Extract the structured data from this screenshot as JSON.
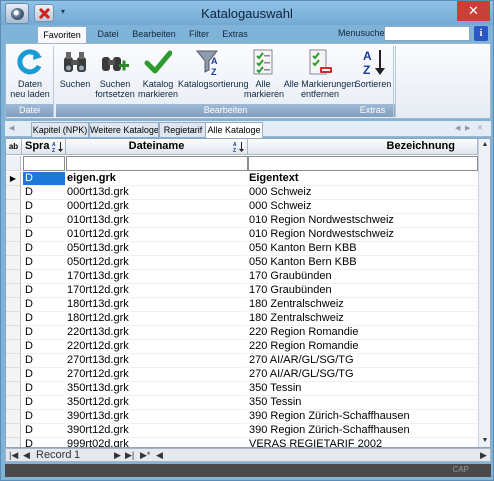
{
  "window": {
    "title": "Katalogauswahl",
    "close_glyph": "✕"
  },
  "qat": {
    "menu_glyph": "▾"
  },
  "ribbon_tabs": [
    "Favoriten",
    "Datei",
    "Bearbeiten",
    "Filter",
    "Extras"
  ],
  "menusuche": {
    "label": "Menusuche",
    "value": ""
  },
  "help_glyph": "i",
  "groups": {
    "datei": {
      "label": "Datei",
      "buttons": [
        {
          "label": "Daten\nneu laden",
          "icon": "refresh-icon"
        }
      ]
    },
    "bearbeiten": {
      "label": "Bearbeiten",
      "buttons": [
        {
          "label": "Suchen",
          "icon": "binoculars-icon"
        },
        {
          "label": "Suchen\nfortsetzen",
          "icon": "binoculars-plus-icon"
        },
        {
          "label": "Katalog\nmarkieren",
          "icon": "checkmark-icon"
        },
        {
          "label": "Katalogsortierung",
          "icon": "funnel-az-icon"
        },
        {
          "label": "Alle\nmarkieren",
          "icon": "checklist-icon"
        },
        {
          "label": "Alle Markierungen\nentfernen",
          "icon": "clear-checklist-icon"
        }
      ]
    },
    "extras": {
      "label": "Extras",
      "buttons": [
        {
          "label": "Sortieren",
          "icon": "sort-az-icon"
        }
      ]
    }
  },
  "sub_tabs": [
    "Kapitel (NPK)",
    "Weitere Kataloge",
    "Regietarif",
    "Alle Kataloge"
  ],
  "grid": {
    "headers": {
      "spra": "Spra",
      "dateiname": "Dateiname",
      "bezeichnung": "Bezeichnung",
      "corner": "ab"
    },
    "rows": [
      {
        "spra": "D",
        "datei": "eigen.grk",
        "bez": "Eigentext"
      },
      {
        "spra": "D",
        "datei": "000rt13d.grk",
        "bez": "000 Schweiz"
      },
      {
        "spra": "D",
        "datei": "000rt12d.grk",
        "bez": "000 Schweiz"
      },
      {
        "spra": "D",
        "datei": "010rt13d.grk",
        "bez": "010 Region Nordwestschweiz"
      },
      {
        "spra": "D",
        "datei": "010rt12d.grk",
        "bez": "010 Region Nordwestschweiz"
      },
      {
        "spra": "D",
        "datei": "050rt13d.grk",
        "bez": "050 Kanton Bern  KBB"
      },
      {
        "spra": "D",
        "datei": "050rt12d.grk",
        "bez": "050 Kanton Bern  KBB"
      },
      {
        "spra": "D",
        "datei": "170rt13d.grk",
        "bez": "170 Graubünden"
      },
      {
        "spra": "D",
        "datei": "170rt12d.grk",
        "bez": "170 Graubünden"
      },
      {
        "spra": "D",
        "datei": "180rt13d.grk",
        "bez": "180 Zentralschweiz"
      },
      {
        "spra": "D",
        "datei": "180rt12d.grk",
        "bez": "180 Zentralschweiz"
      },
      {
        "spra": "D",
        "datei": "220rt13d.grk",
        "bez": "220 Region Romandie"
      },
      {
        "spra": "D",
        "datei": "220rt12d.grk",
        "bez": "220 Region Romandie"
      },
      {
        "spra": "D",
        "datei": "270rt13d.grk",
        "bez": "270 AI/AR/GL/SG/TG"
      },
      {
        "spra": "D",
        "datei": "270rt12d.grk",
        "bez": "270 AI/AR/GL/SG/TG"
      },
      {
        "spra": "D",
        "datei": "350rt13d.grk",
        "bez": "350 Tessin"
      },
      {
        "spra": "D",
        "datei": "350rt12d.grk",
        "bez": "350 Tessin"
      },
      {
        "spra": "D",
        "datei": "390rt13d.grk",
        "bez": "390 Region Zürich-Schaffhausen"
      },
      {
        "spra": "D",
        "datei": "390rt12d.grk",
        "bez": "390 Region Zürich-Schaffhausen"
      },
      {
        "spra": "D",
        "datei": "999rt02d.grk",
        "bez": "VERAS REGIETARIF 2002"
      }
    ]
  },
  "navbar": {
    "label": "Record",
    "value": "1"
  },
  "status": {
    "cap": "CAP"
  }
}
